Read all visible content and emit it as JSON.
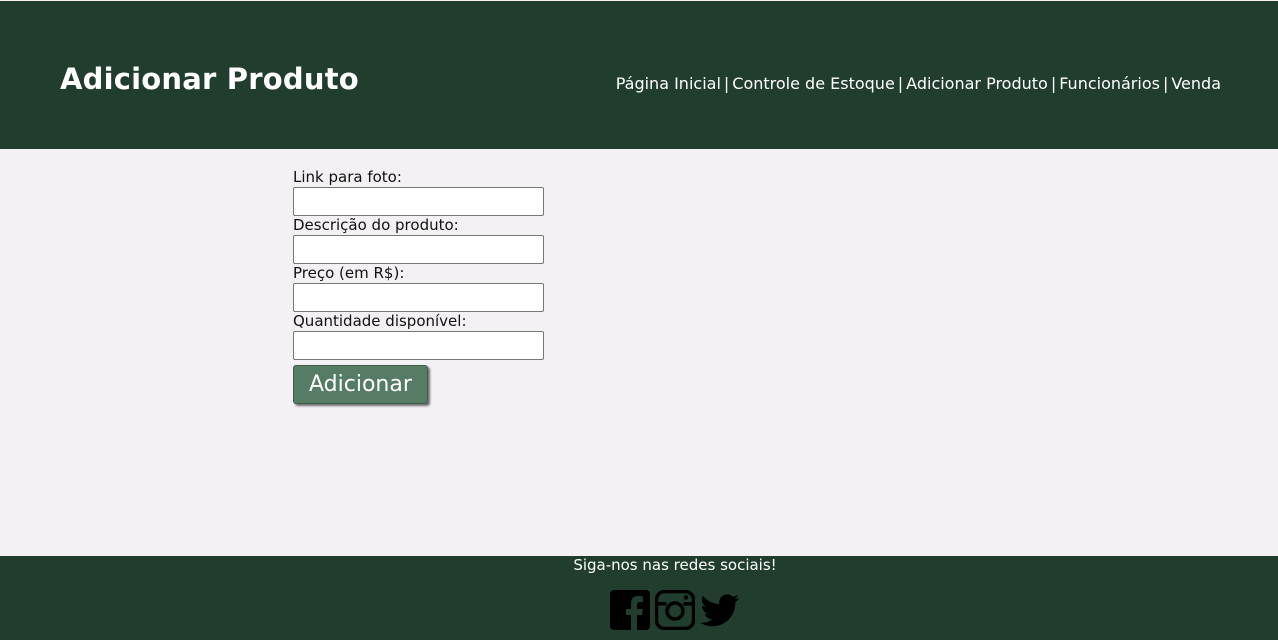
{
  "header": {
    "title": "Adicionar Produto",
    "nav": [
      {
        "label": "Página Inicial"
      },
      {
        "label": "Controle de Estoque"
      },
      {
        "label": "Adicionar Produto"
      },
      {
        "label": "Funcionários"
      },
      {
        "label": "Venda"
      }
    ],
    "separator": "|"
  },
  "form": {
    "fields": [
      {
        "label": "Link para foto:",
        "value": "",
        "placeholder": ""
      },
      {
        "label": "Descrição do produto:",
        "value": "",
        "placeholder": ""
      },
      {
        "label": "Preço (em R$):",
        "value": "",
        "placeholder": ""
      },
      {
        "label": "Quantidade disponível:",
        "value": "",
        "placeholder": ""
      }
    ],
    "submit_label": "Adicionar"
  },
  "footer": {
    "text": "Siga-nos nas redes sociais!",
    "icons": [
      "facebook-icon",
      "instagram-icon",
      "twitter-icon"
    ]
  },
  "colors": {
    "header_bg": "#203d2e",
    "page_bg": "#f4f1f4",
    "button_bg": "#577c66",
    "text_light": "#ffffff"
  }
}
